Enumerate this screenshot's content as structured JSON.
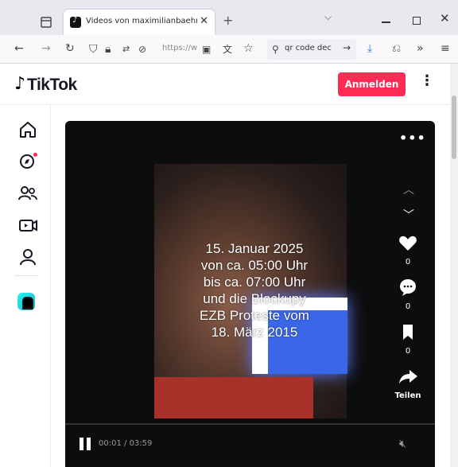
{
  "browser": {
    "tab_title": "Videos von maximilianbaehring",
    "url": "https://w",
    "search_query": "qr code dec"
  },
  "tiktok": {
    "logo": "TikTok",
    "login_label": "Anmelden",
    "brand_color": "#fe2c55"
  },
  "sidebar": {
    "items": [
      "home-icon",
      "explore-icon",
      "following-icon",
      "live-icon",
      "profile-icon",
      "coin-icon"
    ]
  },
  "video": {
    "caption_lines": [
      "15. Januar 2025",
      "von ca. 05:00 Uhr",
      "bis ca. 07:00 Uhr",
      "und die Blockupy",
      "EZB Proteste vom",
      "18. März 2015"
    ],
    "like_count": "0",
    "comment_count": "0",
    "save_count": "0",
    "share_label": "Teilen",
    "time_current": "00:01",
    "time_total": "03:59"
  }
}
